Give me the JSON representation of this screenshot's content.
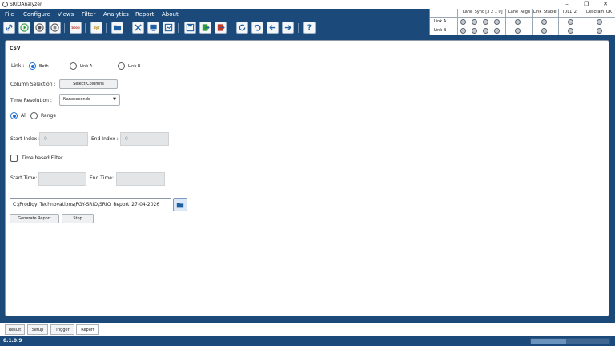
{
  "window": {
    "title": "SRIOAnalyzer",
    "minimize": "–",
    "restore": "❐",
    "close": "✕"
  },
  "menu": [
    "File",
    "Configure",
    "Views",
    "Filter",
    "Analytics",
    "Report",
    "About"
  ],
  "toolbar": {
    "stop_label": "Stop",
    "byte_label": "Byt",
    "help_label": "?",
    "buttons": [
      "link-icon",
      "play-icon",
      "record-icon",
      "record-stop-icon",
      "stop-icon",
      "byte-icon",
      "folder-icon",
      "tools-icon",
      "monitor-icon",
      "chart-window-icon",
      "save-icon",
      "export-green-icon",
      "export-red-icon",
      "refresh-icon",
      "undo-icon",
      "back-icon",
      "forward-icon",
      "help-icon"
    ]
  },
  "status_grid": {
    "headers": [
      "Lane_Sync [3 2 1 0]",
      "Lane_Align",
      "Link_Stable",
      "IDL1_2",
      "Descram_OK"
    ],
    "rows": [
      {
        "label": "Link A"
      },
      {
        "label": "Link B"
      }
    ],
    "led_color_off": "#c5cbd1"
  },
  "panel": {
    "title": "CSV",
    "link_label": "Link :",
    "link_options": [
      "Both",
      "Link A",
      "Link B"
    ],
    "link_selected": "Both",
    "column_selection_label": "Column Selection :",
    "select_columns_button": "Select Columns",
    "time_resolution_label": "Time Resolution :",
    "time_resolution_value": "Nanoseconds",
    "range_options": [
      "All",
      "Range"
    ],
    "range_selected": "All",
    "start_index_label": "Start Index :",
    "start_index_value": "0",
    "end_index_label": "End Index :",
    "end_index_value": "0",
    "time_filter_label": "Time based Filter",
    "time_filter_checked": false,
    "start_time_label": "Start Time:",
    "start_time_value": "",
    "end_time_label": "End Time:",
    "end_time_value": "",
    "path_value": "C:\\Prodigy_Technovations\\PGY-SRIO\\SRIO_Report_27-04-2026_",
    "generate_button": "Generate Report",
    "stop_button": "Stop"
  },
  "tabs": [
    "Result",
    "Setup",
    "Trigger",
    "Report"
  ],
  "statusbar": {
    "version": "0.1.0.9",
    "progress_fraction": 0.45
  },
  "colors": {
    "chrome_blue": "#1b4a7a",
    "accent": "#1d6fd8"
  }
}
